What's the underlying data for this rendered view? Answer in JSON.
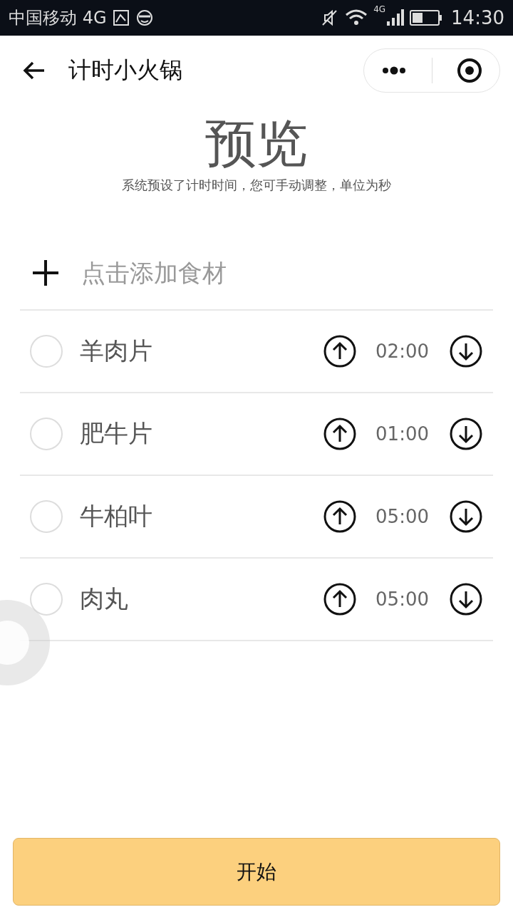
{
  "status_bar": {
    "carrier": "中国移动 4G",
    "network": "4G",
    "time": "14:30"
  },
  "nav": {
    "title": "计时小火锅"
  },
  "header": {
    "title": "预览",
    "subtitle": "系统预设了计时时间，您可手动调整，单位为秒"
  },
  "add_item": {
    "placeholder": "点击添加食材"
  },
  "items": [
    {
      "name": "羊肉片",
      "time": "02:00",
      "checked": false
    },
    {
      "name": "肥牛片",
      "time": "01:00",
      "checked": false
    },
    {
      "name": "牛柏叶",
      "time": "05:00",
      "checked": false
    },
    {
      "name": "肉丸",
      "time": "05:00",
      "checked": false
    }
  ],
  "start_button": "开始"
}
